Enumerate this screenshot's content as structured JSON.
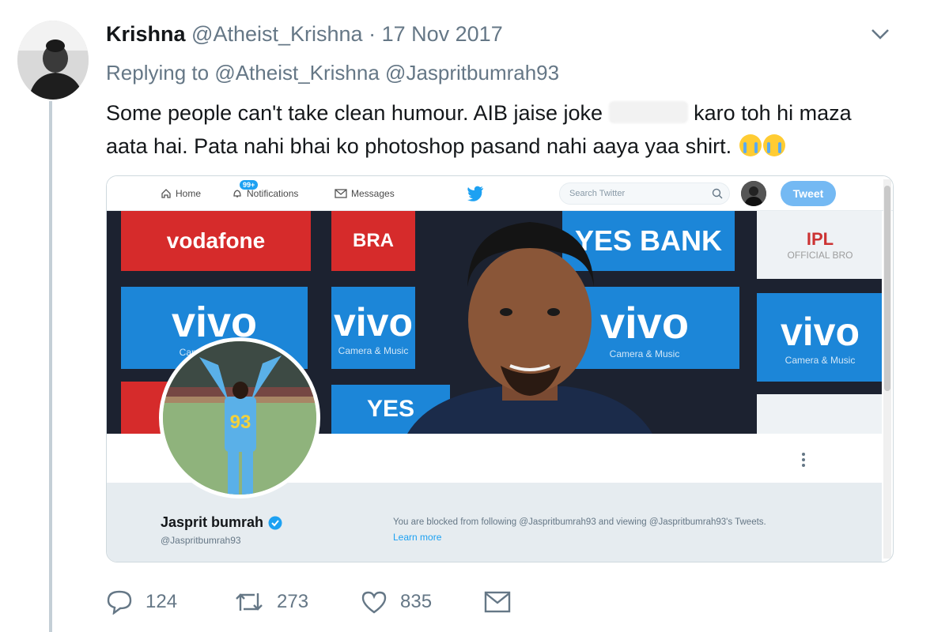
{
  "tweet": {
    "author_name": "Krishna",
    "author_handle": "@Atheist_Krishna",
    "separator": "·",
    "date": "17 Nov 2017",
    "replying_prefix": "Replying to",
    "replying_mentions": [
      "@Atheist_Krishna",
      "@Jaspritbumrah93"
    ],
    "text_line1_a": "Some people can't take clean humour.  AIB jaise joke",
    "text_line1_b": "karo toh hi maza",
    "text_line2": "aata hai. Pata nahi bhai ko photoshop pasand nahi aaya yaa shirt.",
    "emoji_names": [
      "loudly-crying-face-emoji",
      "loudly-crying-face-emoji"
    ]
  },
  "embed": {
    "nav": {
      "home_label": "Home",
      "notifications_badge": "99+",
      "notifications_label": "Notifications",
      "messages_label": "Messages",
      "search_placeholder": "Search Twitter",
      "tweet_button_label": "Tweet"
    },
    "banner_ads": {
      "vodafone": "vodafone",
      "brand_top": "BRA",
      "yes_bank": "YES BANK",
      "ipl": "IPL",
      "official": "OFFICIAL BRO",
      "vivo": "vivo",
      "vivo_sub": "Camera & Music",
      "yes_bottom": "YES"
    },
    "profile": {
      "name": "Jasprit bumrah",
      "handle": "@Jaspritbumrah93",
      "jersey_number": "93",
      "blocked_text": "You are blocked from following @Jaspritbumrah93 and viewing @Jaspritbumrah93's Tweets.",
      "learn_more": "Learn more"
    }
  },
  "actions": {
    "reply_count": "124",
    "retweet_count": "273",
    "like_count": "835"
  },
  "colors": {
    "twitter_blue": "#1da1f2",
    "text_primary": "#14171a",
    "text_secondary": "#657786",
    "thread_line": "#c4cfd6",
    "tweet_button": "#74b9f3"
  }
}
